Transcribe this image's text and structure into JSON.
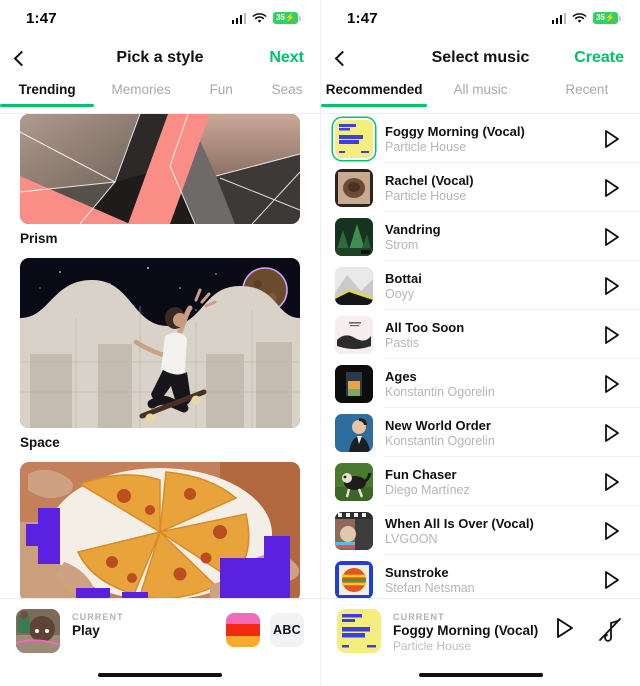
{
  "left": {
    "status": {
      "time": "1:47",
      "battery": "35",
      "charging": true
    },
    "nav": {
      "back": "back-arrow",
      "title": "Pick a style",
      "action": "Next"
    },
    "tabs": [
      {
        "label": "Trending",
        "active": true
      },
      {
        "label": "Memories",
        "active": false
      },
      {
        "label": "Fun",
        "active": false
      },
      {
        "label": "Seas",
        "active": false
      }
    ],
    "styles": [
      {
        "label": "Prism",
        "art": "geometric-portrait-collage"
      },
      {
        "label": "Space",
        "art": "skateboarder-planet"
      },
      {
        "label": "",
        "art": "pizza-slices-purple-blocks"
      }
    ],
    "bottom": {
      "kicker": "CURRENT",
      "title": "Play",
      "subtitle": "",
      "color_button": "color-swatch",
      "text_button": "ABC"
    }
  },
  "right": {
    "status": {
      "time": "1:47",
      "battery": "35",
      "charging": true
    },
    "nav": {
      "back": "back-arrow",
      "title": "Select music",
      "action": "Create"
    },
    "tabs": [
      {
        "label": "Recommended",
        "active": true
      },
      {
        "label": "All music",
        "active": false
      },
      {
        "label": "Recent",
        "active": false
      }
    ],
    "tracks": [
      {
        "title": "Foggy Morning (Vocal)",
        "artist": "Particle House",
        "selected": true,
        "art": "particle-house-yellow"
      },
      {
        "title": "Rachel (Vocal)",
        "artist": "Particle House",
        "selected": false,
        "art": "brown-circle"
      },
      {
        "title": "Vandring",
        "artist": "Strom",
        "selected": false,
        "art": "green-forest"
      },
      {
        "title": "Bottai",
        "artist": "Ooyy",
        "selected": false,
        "art": "grey-mountain"
      },
      {
        "title": "All Too Soon",
        "artist": "Pastis",
        "selected": false,
        "art": "black-brushstroke"
      },
      {
        "title": "Ages",
        "artist": "Konstantin Ogorelin",
        "selected": false,
        "art": "dark-sunset-door"
      },
      {
        "title": "New World Order",
        "artist": "Konstantin Ogorelin",
        "selected": false,
        "art": "blue-portrait"
      },
      {
        "title": "Fun Chaser",
        "artist": "Diego Martínez",
        "selected": false,
        "art": "dog-grass"
      },
      {
        "title": "When All Is Over (Vocal)",
        "artist": "LVGOON",
        "selected": false,
        "art": "collage-photo"
      },
      {
        "title": "Sunstroke",
        "artist": "Stefan Netsman",
        "selected": false,
        "art": "blue-border-sun"
      }
    ],
    "bottom": {
      "kicker": "CURRENT",
      "title": "Foggy Morning (Vocal)",
      "subtitle": "Particle House",
      "play": "play-icon",
      "mute": "music-note-muted-icon"
    }
  },
  "colors": {
    "accent": "#00c46a",
    "battery": "#32d15c",
    "text": "#111111",
    "muted": "#b5b5b5",
    "swatch_top": "#f06bb8",
    "swatch_mid": "#f22a15",
    "swatch_bottom": "#fbaa2a"
  }
}
